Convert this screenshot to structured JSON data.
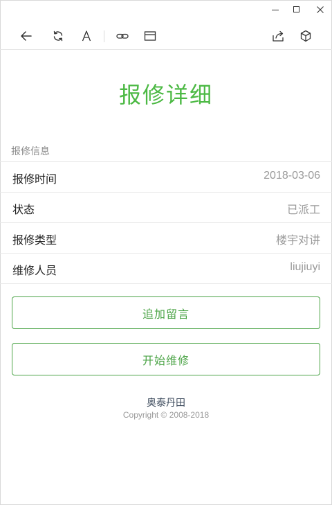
{
  "window": {
    "minimize_icon": "minimize-icon",
    "maximize_icon": "maximize-icon",
    "close_icon": "close-icon"
  },
  "toolbar": {
    "icons": [
      "back-arrow-icon",
      "refresh-icon",
      "font-size-icon",
      "link-icon",
      "window-icon",
      "share-icon",
      "cube-icon"
    ]
  },
  "page": {
    "title": "报修详细"
  },
  "info": {
    "section_label": "报修信息",
    "rows": [
      {
        "label": "报修时间",
        "value": "2018-03-06"
      },
      {
        "label": "状态",
        "value": "已派工"
      },
      {
        "label": "报修类型",
        "value": "楼宇对讲"
      },
      {
        "label": "维修人员",
        "value": "liujiuyi"
      }
    ]
  },
  "actions": {
    "add_message": "追加留言",
    "start_repair": "开始维修"
  },
  "footer": {
    "company": "奥泰丹田",
    "copyright": "Copyright © 2008-2018"
  },
  "colors": {
    "accent": "#4cb944",
    "button_border": "#4aa345",
    "muted": "#9a9a9a"
  }
}
